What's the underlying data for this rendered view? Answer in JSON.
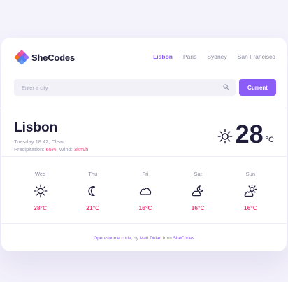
{
  "brand": {
    "name": "SheCodes"
  },
  "nav": {
    "items": [
      "Lisbon",
      "Paris",
      "Sydney",
      "San Francisco"
    ],
    "active": "Lisbon"
  },
  "search": {
    "placeholder": "Enter a city",
    "value": "",
    "button_label": "Current"
  },
  "weather": {
    "city": "Lisbon",
    "datetime": "Tuesday 18:42",
    "description": "Clear",
    "precipitation_label": "Precipitation:",
    "precipitation": "65%",
    "wind_label": "Wind:",
    "wind": "3km/h",
    "temperature": "28",
    "unit": "°C",
    "icon": "sun-icon"
  },
  "forecast": [
    {
      "day": "Wed",
      "temp": "28°C",
      "icon": "sun-icon"
    },
    {
      "day": "Thu",
      "temp": "21°C",
      "icon": "moon-icon"
    },
    {
      "day": "Fri",
      "temp": "16°C",
      "icon": "cloud-icon"
    },
    {
      "day": "Sat",
      "temp": "16°C",
      "icon": "cloud-moon-icon"
    },
    {
      "day": "Sun",
      "temp": "16°C",
      "icon": "cloud-sun-icon"
    }
  ],
  "footer": {
    "link1": "Open-source code",
    "by": ", by ",
    "author": "Matt Delac",
    "from": " from ",
    "org": "SheCodes"
  },
  "colors": {
    "accent": "#8b5cf6",
    "highlight": "#e8467c",
    "text": "#1f1d3a",
    "background": "#f4f2fb"
  }
}
